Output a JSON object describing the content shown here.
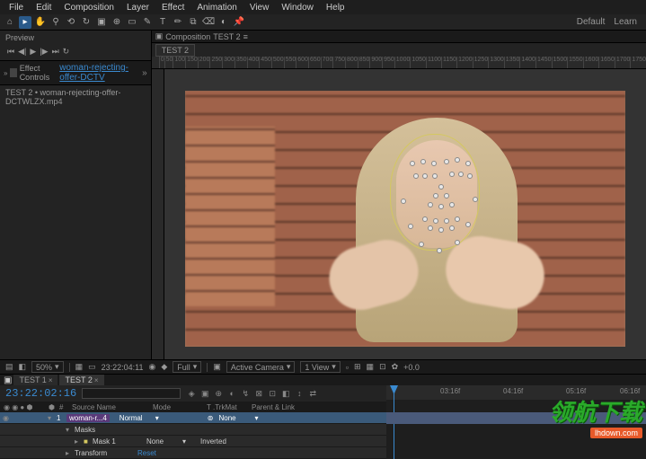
{
  "menu": {
    "file": "File",
    "edit": "Edit",
    "composition": "Composition",
    "layer": "Layer",
    "effect": "Effect",
    "animation": "Animation",
    "view": "View",
    "window": "Window",
    "help": "Help"
  },
  "toolbarRight": {
    "default": "Default",
    "learn": "Learn"
  },
  "leftPanel": {
    "preview": "Preview",
    "effectControls": "Effect Controls",
    "layerLink": "woman-rejecting-offer-DCTV",
    "sourceLine": "TEST 2 • woman-rejecting-offer-DCTWLZX.mp4"
  },
  "compPanel": {
    "prefix": "Composition",
    "name": "TEST 2",
    "subtab": "TEST 2"
  },
  "ruler": [
    "0",
    "50",
    "100",
    "150",
    "200",
    "250",
    "300",
    "350",
    "400",
    "450",
    "500",
    "550",
    "600",
    "650",
    "700",
    "750",
    "800",
    "850",
    "900",
    "950",
    "1000",
    "1050",
    "1100",
    "1150",
    "1200",
    "1250",
    "1300",
    "1350",
    "1400",
    "1450",
    "1500",
    "1550",
    "1600",
    "1650",
    "1700",
    "1750"
  ],
  "viewCtl": {
    "zoom": "50%",
    "tc": "23:22:04:11",
    "res": "Full",
    "camera": "Active Camera",
    "views": "1 View",
    "plus": "+0.0"
  },
  "timeline": {
    "tabs": [
      "TEST 1",
      "TEST 2"
    ],
    "activeTab": 1,
    "timecode": "23:22:02:16",
    "headers": {
      "num": "#",
      "source": "Source Name",
      "mode": "Mode",
      "trkmat": "T .TrkMat",
      "parent": "Parent & Link"
    },
    "layer1": {
      "num": "1",
      "name": "woman-r...4",
      "mode": "Normal",
      "parent": "None"
    },
    "masks": "Masks",
    "mask1": {
      "name": "Mask 1",
      "mode": "None",
      "inverted": "Inverted"
    },
    "reset": {
      "name": "Transform",
      "value": "Reset"
    },
    "tlRuler": [
      "03:16f",
      "04:16f",
      "05:16f",
      "06:16f"
    ]
  },
  "watermark": {
    "cn": "领航下载",
    "url": "lhdown.com"
  }
}
